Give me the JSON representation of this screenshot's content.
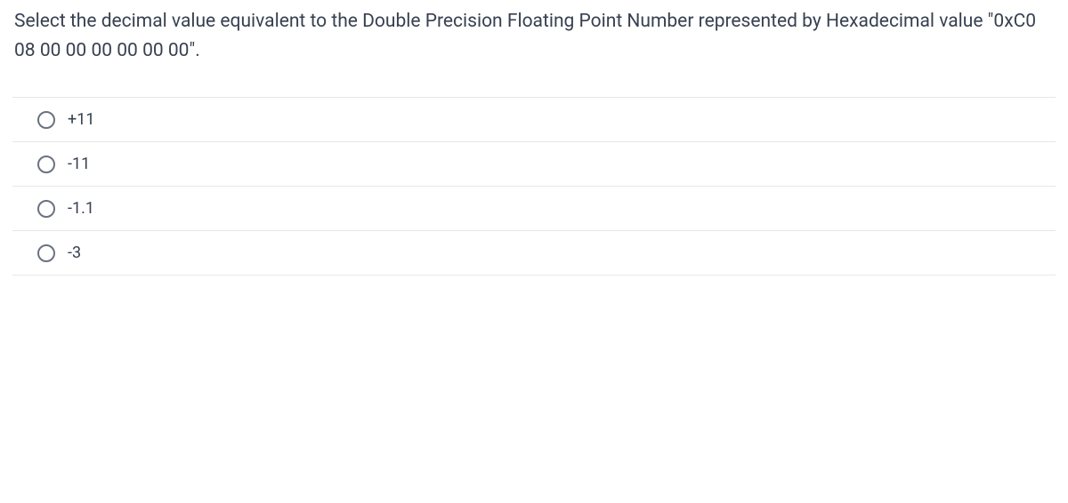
{
  "question": {
    "text": "Select the  decimal value equivalent to the Double Precision Floating Point Number represented by Hexadecimal value  \"0xC0 08 00 00 00 00 00 00\"."
  },
  "options": [
    {
      "label": "+11"
    },
    {
      "label": "-11"
    },
    {
      "label": "-1.1"
    },
    {
      "label": "-3"
    }
  ]
}
